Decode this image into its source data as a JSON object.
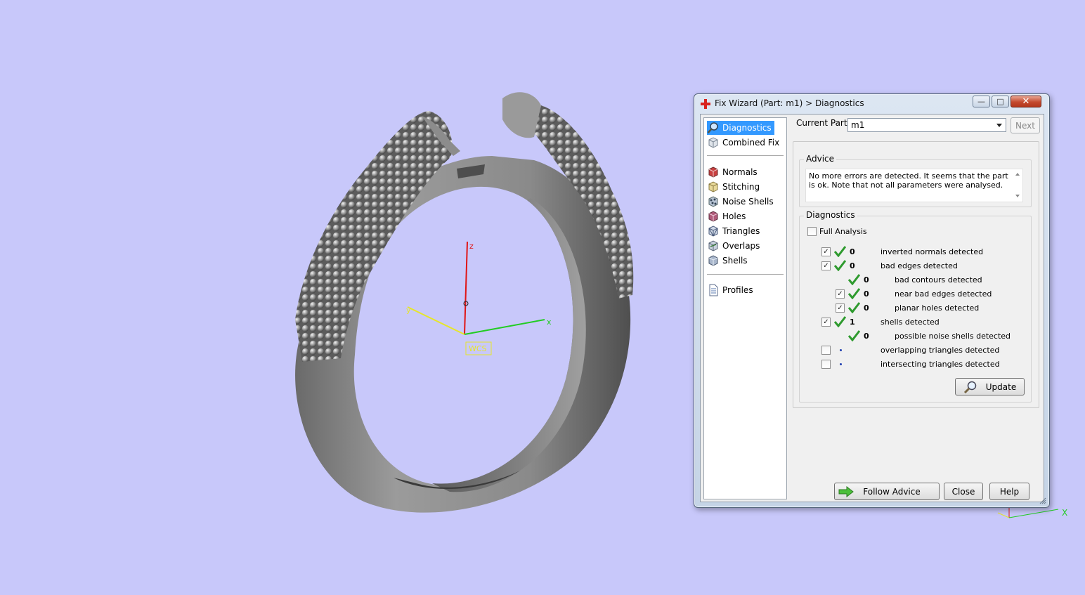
{
  "viewport": {
    "background": "#c8c8fa",
    "axis_labels": {
      "z": "z",
      "y": "y",
      "x": "x",
      "wcs": "WCS"
    },
    "corner_axis_label": "X"
  },
  "dialog": {
    "title": "Fix Wizard (Part: m1) > Diagnostics",
    "title_icon": "red-cross-icon",
    "sidebar": {
      "top_items": [
        {
          "label": "Diagnostics",
          "icon": "magnifier-icon",
          "selected": true
        },
        {
          "label": "Combined Fix",
          "icon": "cube-icon",
          "selected": false
        }
      ],
      "fix_items": [
        {
          "label": "Normals",
          "icon": "normals-cube-icon"
        },
        {
          "label": "Stitching",
          "icon": "stitching-cube-icon"
        },
        {
          "label": "Noise Shells",
          "icon": "noise-shells-icon"
        },
        {
          "label": "Holes",
          "icon": "holes-cube-icon"
        },
        {
          "label": "Triangles",
          "icon": "triangles-cube-icon"
        },
        {
          "label": "Overlaps",
          "icon": "overlaps-cube-icon"
        },
        {
          "label": "Shells",
          "icon": "shells-cube-icon"
        }
      ],
      "bottom_items": [
        {
          "label": "Profiles",
          "icon": "document-icon"
        }
      ]
    },
    "current_part_label": "Current Part:",
    "current_part_value": "m1",
    "next_label": "Next",
    "advice": {
      "legend": "Advice",
      "text": "No more errors are detected. It seems that the part is ok. Note that not all parameters were analysed."
    },
    "diagnostics": {
      "legend": "Diagnostics",
      "full_analysis_label": "Full Analysis",
      "full_analysis_checked": false,
      "rows": [
        {
          "text": "inverted normals detected",
          "count": "0",
          "checkbox": true,
          "checked": true,
          "status": "ok",
          "indent": 0
        },
        {
          "text": "bad edges detected",
          "count": "0",
          "checkbox": true,
          "checked": true,
          "status": "ok",
          "indent": 0
        },
        {
          "text": "bad contours detected",
          "count": "0",
          "checkbox": false,
          "checked": false,
          "status": "ok",
          "indent": 1
        },
        {
          "text": "near bad edges detected",
          "count": "0",
          "checkbox": true,
          "checked": true,
          "status": "ok",
          "indent": 1
        },
        {
          "text": "planar holes detected",
          "count": "0",
          "checkbox": true,
          "checked": true,
          "status": "ok",
          "indent": 1
        },
        {
          "text": "shells detected",
          "count": "1",
          "checkbox": true,
          "checked": true,
          "status": "ok",
          "indent": 0
        },
        {
          "text": "possible noise shells detected",
          "count": "0",
          "checkbox": false,
          "checked": false,
          "status": "ok",
          "indent": 1
        },
        {
          "text": "overlapping triangles detected",
          "count": "",
          "checkbox": true,
          "checked": false,
          "status": "pending",
          "indent": 0
        },
        {
          "text": "intersecting triangles detected",
          "count": "",
          "checkbox": true,
          "checked": false,
          "status": "pending",
          "indent": 0
        }
      ],
      "update_label": "Update"
    },
    "buttons": {
      "follow_advice": "Follow Advice",
      "close": "Close",
      "help": "Help"
    },
    "colors": {
      "selection": "#3399ff",
      "ok_tick": "#2e9a2e",
      "close_button": "#c44a2e"
    }
  }
}
